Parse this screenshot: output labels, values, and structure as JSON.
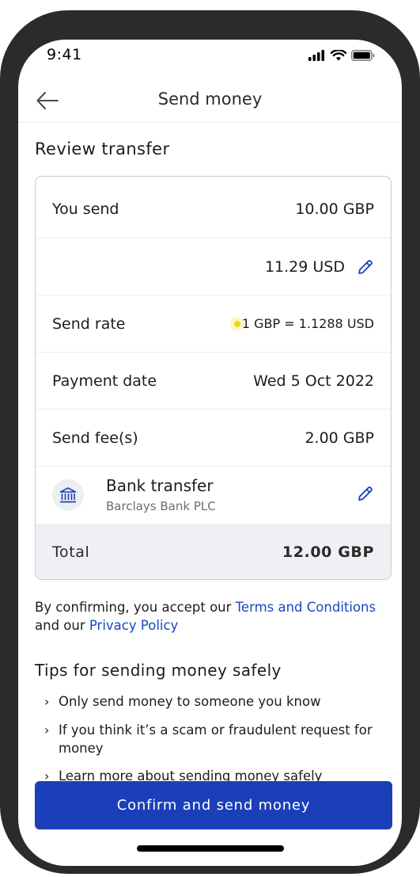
{
  "status_bar": {
    "time": "9:41"
  },
  "header": {
    "title": "Send money"
  },
  "section_title": "Review transfer",
  "transfer": {
    "you_send_label": "You send",
    "you_send_value": "10.00 GBP",
    "recipient_gets_value": "11.29 USD",
    "send_rate_label": "Send rate",
    "send_rate_value": "1 GBP = 1.1288 USD",
    "payment_date_label": "Payment date",
    "payment_date_value": "Wed 5 Oct 2022",
    "send_fee_label": "Send fee(s)",
    "send_fee_value": "2.00 GBP",
    "bank_method": "Bank transfer",
    "bank_name": "Barclays Bank PLC",
    "total_label": "Total",
    "total_value": "12.00 GBP"
  },
  "consent": {
    "prefix": "By confirming, you accept our ",
    "terms_link": "Terms and Conditions",
    "middle": " and our ",
    "privacy_link": "Privacy Policy"
  },
  "tips": {
    "title": "Tips for sending money safely",
    "items": [
      "Only send money to someone you know",
      "If you think it’s a scam or fraudulent request for money",
      "Learn more about sending money safely"
    ]
  },
  "actions": {
    "confirm_label": "Confirm and send money"
  },
  "colors": {
    "primary": "#1a3fb8",
    "link": "#1a47c0",
    "rate_indicator": "#f5d21a",
    "total_bg": "#eef0f4"
  },
  "icons": [
    "back-arrow-icon",
    "signal-icon",
    "wifi-icon",
    "battery-icon",
    "edit-pencil-icon",
    "bank-icon",
    "chevron-right-icon"
  ]
}
